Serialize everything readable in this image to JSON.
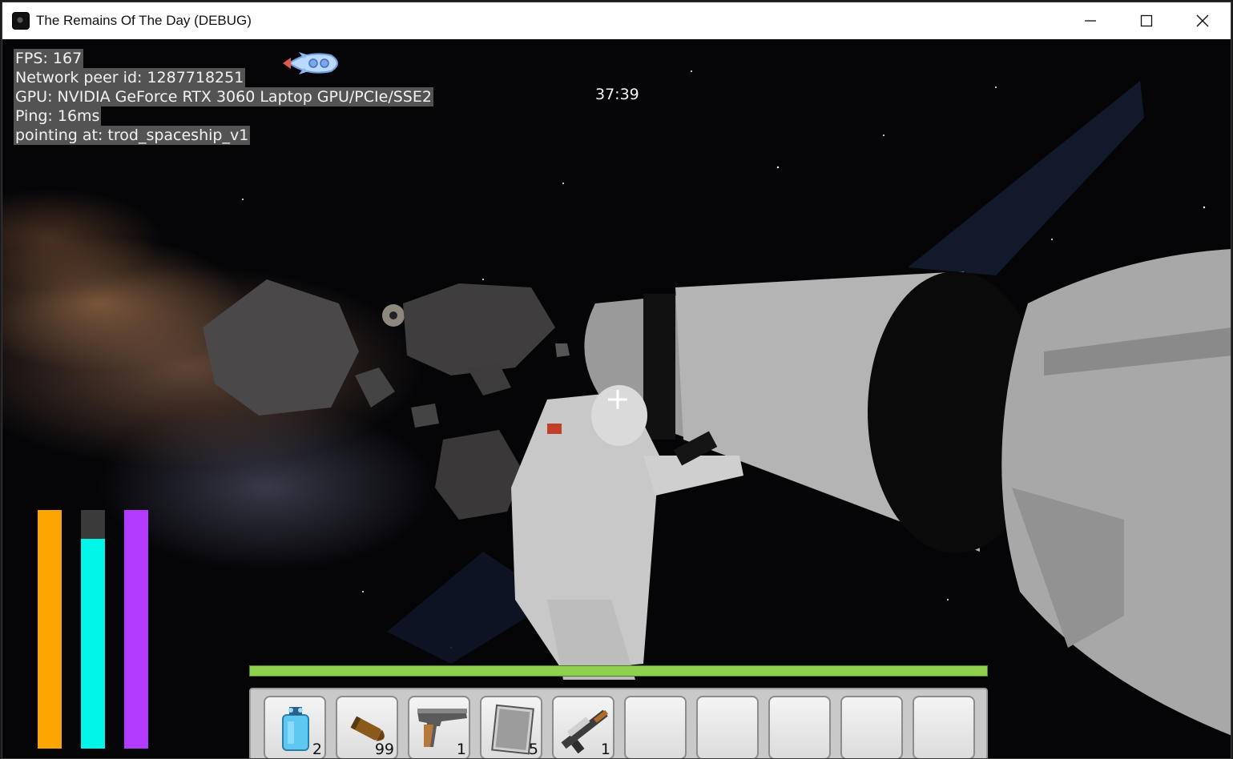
{
  "window": {
    "title": "The Remains Of The Day (DEBUG)",
    "controls": [
      "minimize",
      "maximize",
      "close"
    ]
  },
  "debug": {
    "fps": "FPS: 167",
    "peer": "Network peer id: 1287718251",
    "gpu": "GPU: NVIDIA GeForce RTX 3060 Laptop GPU/PCIe/SSE2",
    "ping": "Ping: 16ms",
    "pointing": "pointing at: trod_spaceship_v1"
  },
  "timer": "37:39",
  "status_bars": [
    {
      "name": "orange-status-bar",
      "color": "#ffa500",
      "level": 1.0
    },
    {
      "name": "cyan-status-bar",
      "color": "#00f5e8",
      "level": 0.88
    },
    {
      "name": "purple-status-bar",
      "color": "#b23bff",
      "level": 1.0
    }
  ],
  "progress": {
    "level": 1.0,
    "color": "#8fd14f"
  },
  "hotbar": {
    "slots": [
      {
        "icon": "oxygen-canister-icon",
        "count": "2"
      },
      {
        "icon": "ammo-bullet-icon",
        "count": "99"
      },
      {
        "icon": "pistol-icon",
        "count": "1"
      },
      {
        "icon": "metal-plate-icon",
        "count": "5"
      },
      {
        "icon": "rifle-icon",
        "count": "1"
      },
      {
        "icon": "",
        "count": ""
      },
      {
        "icon": "",
        "count": ""
      },
      {
        "icon": "",
        "count": ""
      },
      {
        "icon": "",
        "count": ""
      },
      {
        "icon": "",
        "count": ""
      }
    ]
  },
  "colors": {
    "hud_text": "#f2f2f2",
    "debug_bg": "#6e6e6e"
  }
}
